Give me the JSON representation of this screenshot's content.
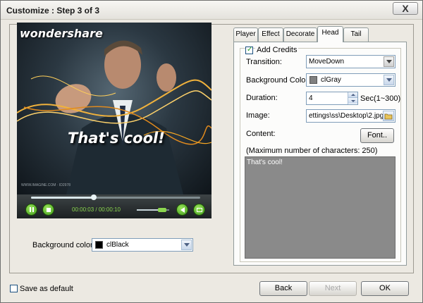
{
  "window": {
    "title": "Customize : Step 3 of 3",
    "close_label": "X"
  },
  "preview": {
    "logo": "wondershare",
    "caption": "That's cool!",
    "watermark": "WWW.IMAGINE.COM · ID2978",
    "time_current": "00:00:03",
    "time_total": "00:00:10",
    "time_separator": " / ",
    "progress": 0.37,
    "volume": 0.78
  },
  "background": {
    "label": "Background color:",
    "value": "clBlack",
    "swatch": "#000000"
  },
  "tabs": [
    {
      "label": "Player",
      "active": false
    },
    {
      "label": "Effect",
      "active": false
    },
    {
      "label": "Decorate",
      "active": false
    },
    {
      "label": "Head",
      "active": true
    },
    {
      "label": "Tail",
      "active": false
    }
  ],
  "head": {
    "add_credits_label": "Add Credits",
    "add_credits_checked": true,
    "transition_label": "Transition:",
    "transition_value": "MoveDown",
    "bgcolor_label": "Background Color:",
    "bgcolor_value": "clGray",
    "bgcolor_swatch": "#808080",
    "duration_label": "Duration:",
    "duration_value": "4",
    "duration_unit": "Sec(1~300)",
    "image_label": "Image:",
    "image_value": "ettings\\ss\\Desktop\\2.jpg",
    "content_label": "Content:",
    "font_button": "Font..",
    "max_chars_note": "(Maximum number of characters: 250)",
    "content_text": "That's cool!"
  },
  "footer": {
    "save_default_label": "Save as default",
    "back_label": "Back",
    "next_label": "Next",
    "ok_label": "OK"
  },
  "colors": {
    "accent_green": "#8bd64f",
    "panel_bg": "#ece9e2",
    "content_bg": "#8a8a8a"
  }
}
